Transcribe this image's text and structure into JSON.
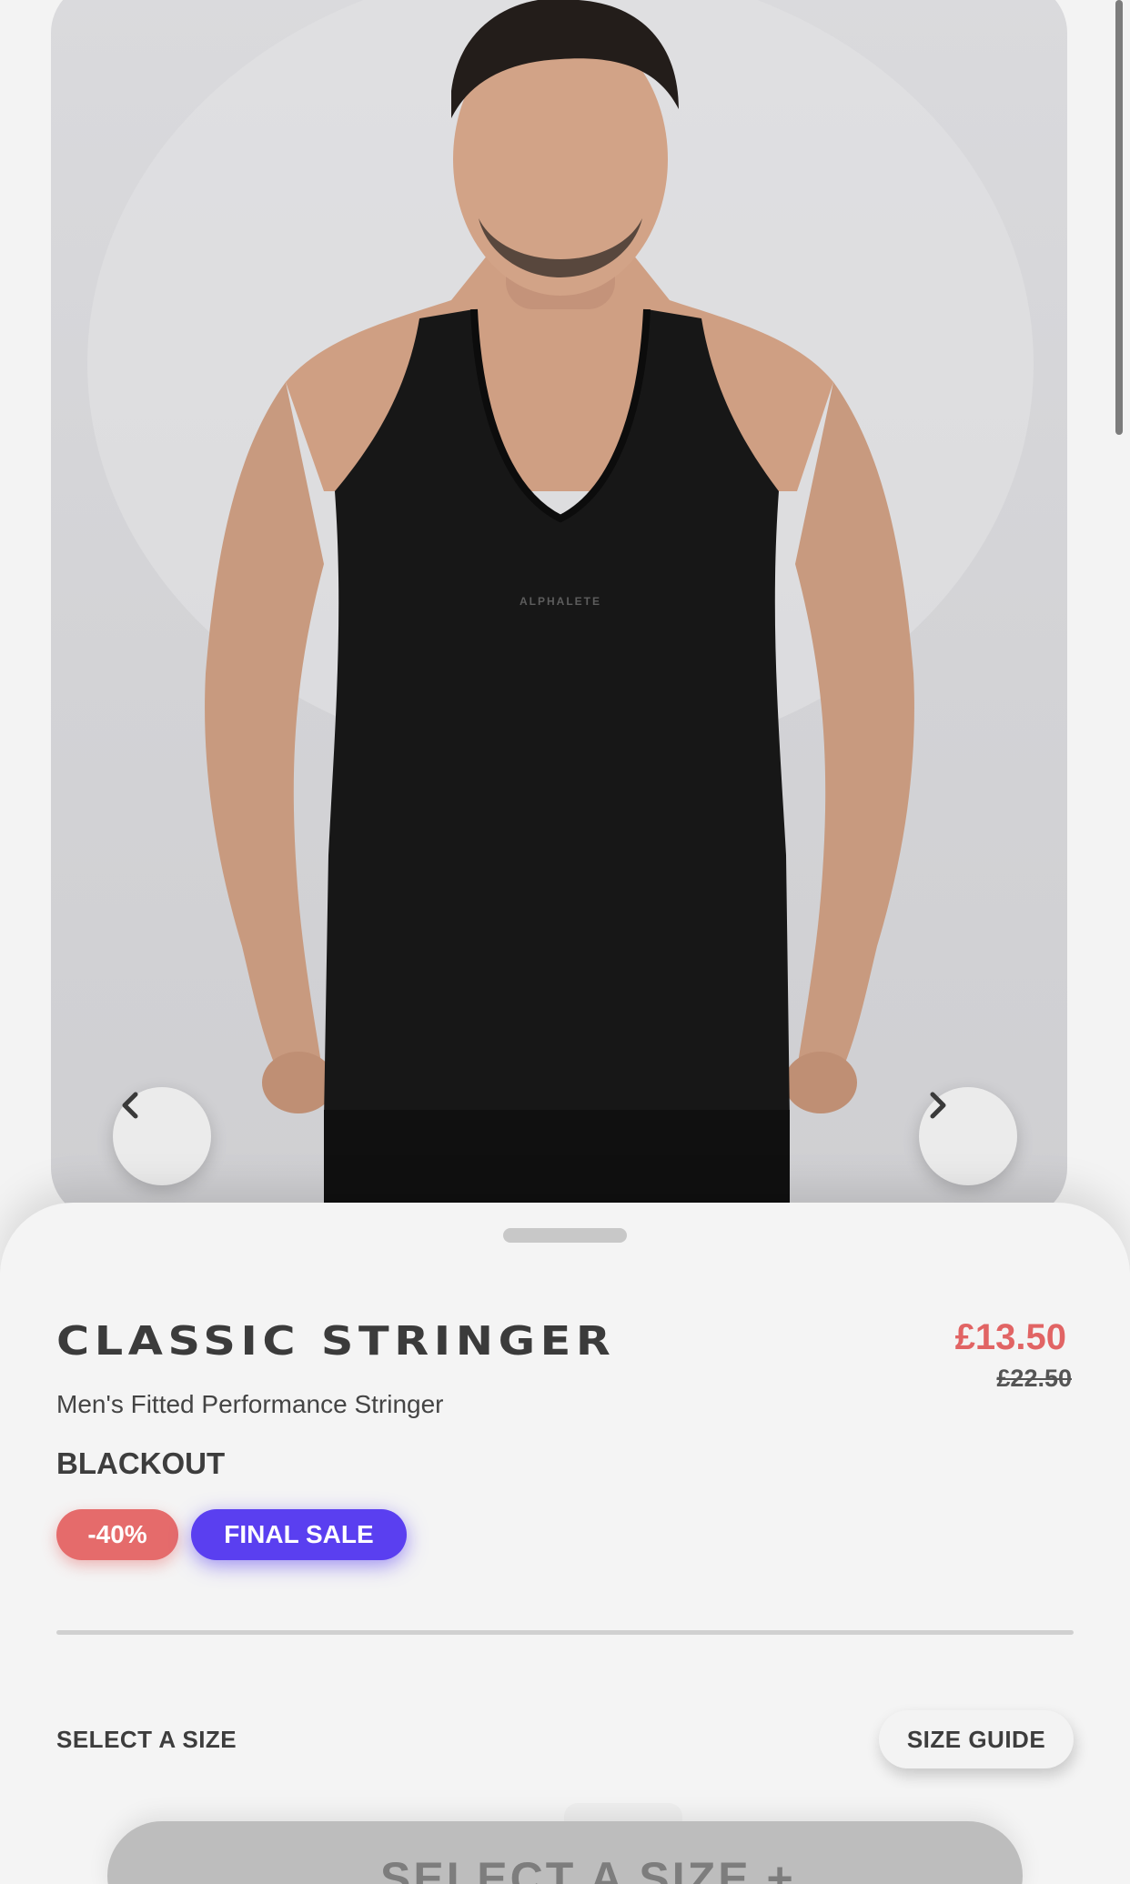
{
  "product": {
    "name": "CLASSIC STRINGER",
    "subtitle": "Men's Fitted Performance Stringer",
    "colour": "BLACKOUT",
    "price_current": "£13.50",
    "price_original": "£22.50",
    "image_logo_text": "ALPHALETE"
  },
  "badges": {
    "discount": "-40%",
    "final_sale": "FINAL SALE"
  },
  "size": {
    "label": "SELECT A SIZE",
    "guide_button": "SIZE GUIDE"
  },
  "cta": {
    "label": "SELECT A SIZE +"
  },
  "icons": {
    "prev": "chevron-left-icon",
    "next": "chevron-right-icon"
  },
  "colors": {
    "price": "#e16464",
    "discount_badge": "#e56b6b",
    "final_sale_badge": "#5a3ff0",
    "background": "#f3f3f3"
  }
}
